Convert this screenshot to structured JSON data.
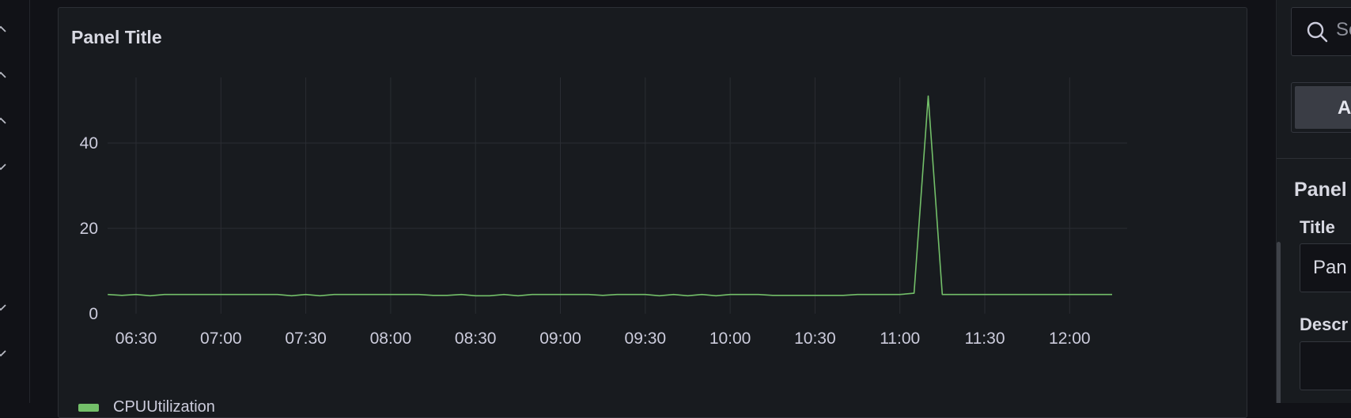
{
  "panel": {
    "title": "Panel Title"
  },
  "chart_data": {
    "type": "line",
    "title": "Panel Title",
    "xlabel": "",
    "ylabel": "",
    "ylim": [
      0,
      55
    ],
    "y_ticks": [
      "0",
      "20",
      "40"
    ],
    "x_ticks": [
      "06:30",
      "07:00",
      "07:30",
      "08:00",
      "08:30",
      "09:00",
      "09:30",
      "10:00",
      "10:30",
      "11:00",
      "11:30",
      "12:00"
    ],
    "grid": true,
    "legend_placement": "bottom-left",
    "series": [
      {
        "name": "CPUUtilization",
        "color": "#73bf69",
        "x": [
          "06:20",
          "06:25",
          "06:30",
          "06:35",
          "06:40",
          "06:45",
          "06:50",
          "06:55",
          "07:00",
          "07:05",
          "07:10",
          "07:15",
          "07:20",
          "07:25",
          "07:30",
          "07:35",
          "07:40",
          "07:45",
          "07:50",
          "07:55",
          "08:00",
          "08:05",
          "08:10",
          "08:15",
          "08:20",
          "08:25",
          "08:30",
          "08:35",
          "08:40",
          "08:45",
          "08:50",
          "08:55",
          "09:00",
          "09:05",
          "09:10",
          "09:15",
          "09:20",
          "09:25",
          "09:30",
          "09:35",
          "09:40",
          "09:45",
          "09:50",
          "09:55",
          "10:00",
          "10:05",
          "10:10",
          "10:15",
          "10:20",
          "10:25",
          "10:30",
          "10:35",
          "10:40",
          "10:45",
          "10:50",
          "10:55",
          "11:00",
          "11:05",
          "11:10",
          "11:15",
          "11:20",
          "11:25",
          "11:30",
          "11:35",
          "11:40",
          "11:45",
          "11:50",
          "11:55",
          "12:00",
          "12:05",
          "12:10",
          "12:15"
        ],
        "values": [
          4.5,
          4.3,
          4.5,
          4.2,
          4.5,
          4.5,
          4.5,
          4.5,
          4.5,
          4.5,
          4.5,
          4.5,
          4.5,
          4.2,
          4.5,
          4.2,
          4.5,
          4.5,
          4.5,
          4.5,
          4.5,
          4.5,
          4.5,
          4.3,
          4.3,
          4.5,
          4.2,
          4.2,
          4.5,
          4.2,
          4.5,
          4.5,
          4.5,
          4.5,
          4.5,
          4.3,
          4.5,
          4.5,
          4.5,
          4.2,
          4.5,
          4.2,
          4.5,
          4.2,
          4.5,
          4.5,
          4.5,
          4.3,
          4.3,
          4.3,
          4.3,
          4.3,
          4.3,
          4.5,
          4.5,
          4.5,
          4.5,
          4.8,
          51,
          4.5,
          4.5,
          4.5,
          4.5,
          4.5,
          4.5,
          4.5,
          4.5,
          4.5,
          4.5,
          4.5,
          4.5,
          4.5
        ]
      }
    ]
  },
  "left_strip": {
    "icon": "chevron-down-icon"
  },
  "right_pane": {
    "search_placeholder": "Se",
    "active_tab": "A",
    "section_heading": "Panel",
    "title_label": "Title",
    "title_value": "Pan",
    "description_label": "Descr"
  }
}
